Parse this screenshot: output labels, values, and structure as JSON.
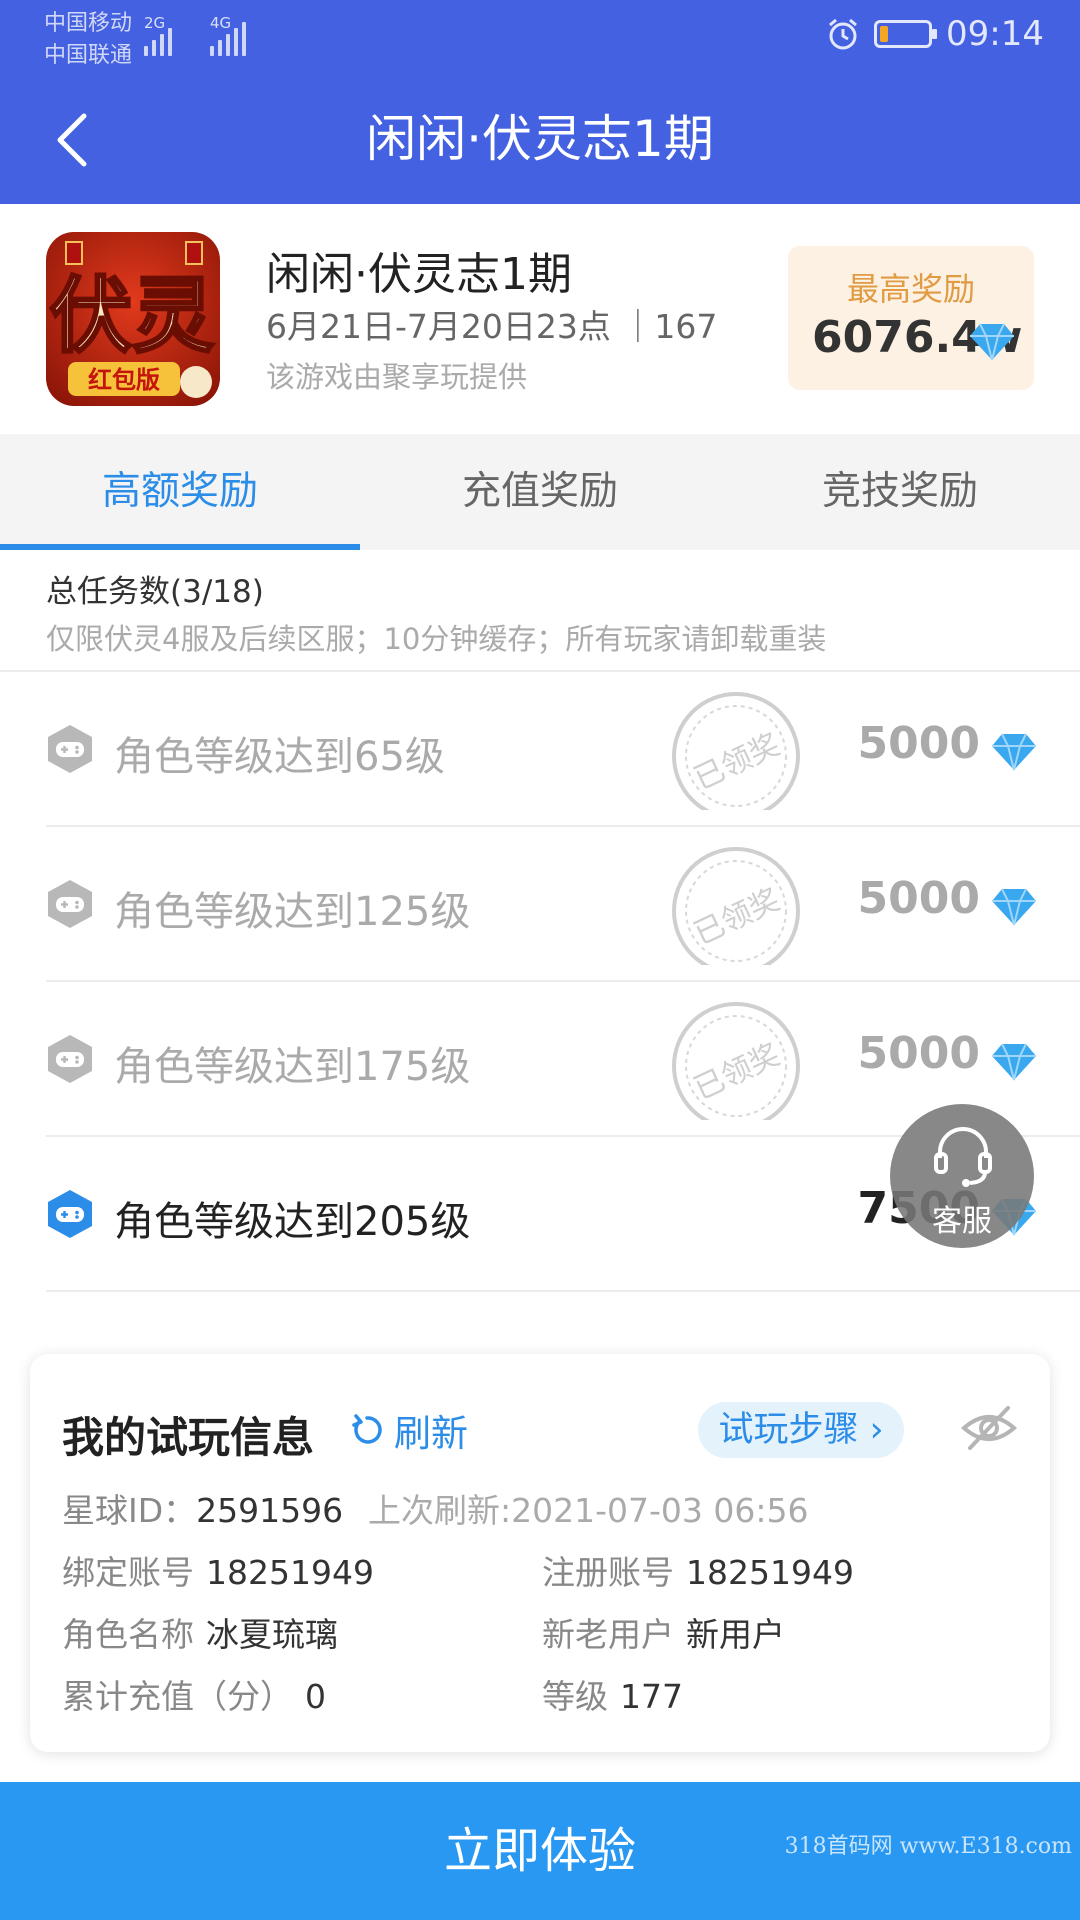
{
  "status_bar": {
    "carrier1": "中国移动",
    "carrier2": "中国联通",
    "net1": "2G",
    "net2": "4G",
    "time": "09:14",
    "battery_level": 0.15
  },
  "nav": {
    "title": "闲闲·伏灵志1期"
  },
  "game": {
    "name": "闲闲·伏灵志1期",
    "date_range": "6月21日-7月20日23点",
    "count": "167",
    "provider": "该游戏由聚享玩提供",
    "icon_text": "伏灵",
    "icon_badge": "红包版"
  },
  "reward_box": {
    "label": "最高奖励",
    "value": "6076.4w"
  },
  "tabs": [
    {
      "label": "高额奖励",
      "active": true
    },
    {
      "label": "充值奖励",
      "active": false
    },
    {
      "label": "竞技奖励",
      "active": false
    }
  ],
  "task_summary": {
    "count": "总任务数(3/18)",
    "note": "仅限伏灵4服及后续区服；10分钟缓存；所有玩家请卸载重装"
  },
  "tasks": [
    {
      "title": "角色等级达到65级",
      "reward": "5000",
      "status": "已领奖"
    },
    {
      "title": "角色等级达到125级",
      "reward": "5000",
      "status": "已领奖"
    },
    {
      "title": "角色等级达到175级",
      "reward": "5000",
      "status": "已领奖"
    },
    {
      "title": "角色等级达到205级",
      "reward": "7500",
      "status": ""
    }
  ],
  "customer_service": {
    "label": "客服"
  },
  "info": {
    "title": "我的试玩信息",
    "refresh": "刷新",
    "steps": "试玩步骤 ›",
    "star_id_label": "星球ID：",
    "star_id": "2591596",
    "last_refresh": "上次刷新:2021-07-03 06:56",
    "bind_label": "绑定账号",
    "bind_value": "18251949",
    "reg_label": "注册账号",
    "reg_value": "18251949",
    "role_label": "角色名称",
    "role_value": "冰夏琉璃",
    "user_type_label": "新老用户",
    "user_type_value": "新用户",
    "recharge_label": "累计充值（分）",
    "recharge_value": "0",
    "level_label": "等级",
    "level_value": "177"
  },
  "cta": {
    "label": "立即体验"
  },
  "watermark": "318首码网 www.E318.com",
  "colors": {
    "nav_bg": "#4361e0",
    "accent": "#2b8de8",
    "cta_bg": "#2998f2",
    "reward_orange": "#e09b43",
    "gem": "#3aa8ef"
  }
}
